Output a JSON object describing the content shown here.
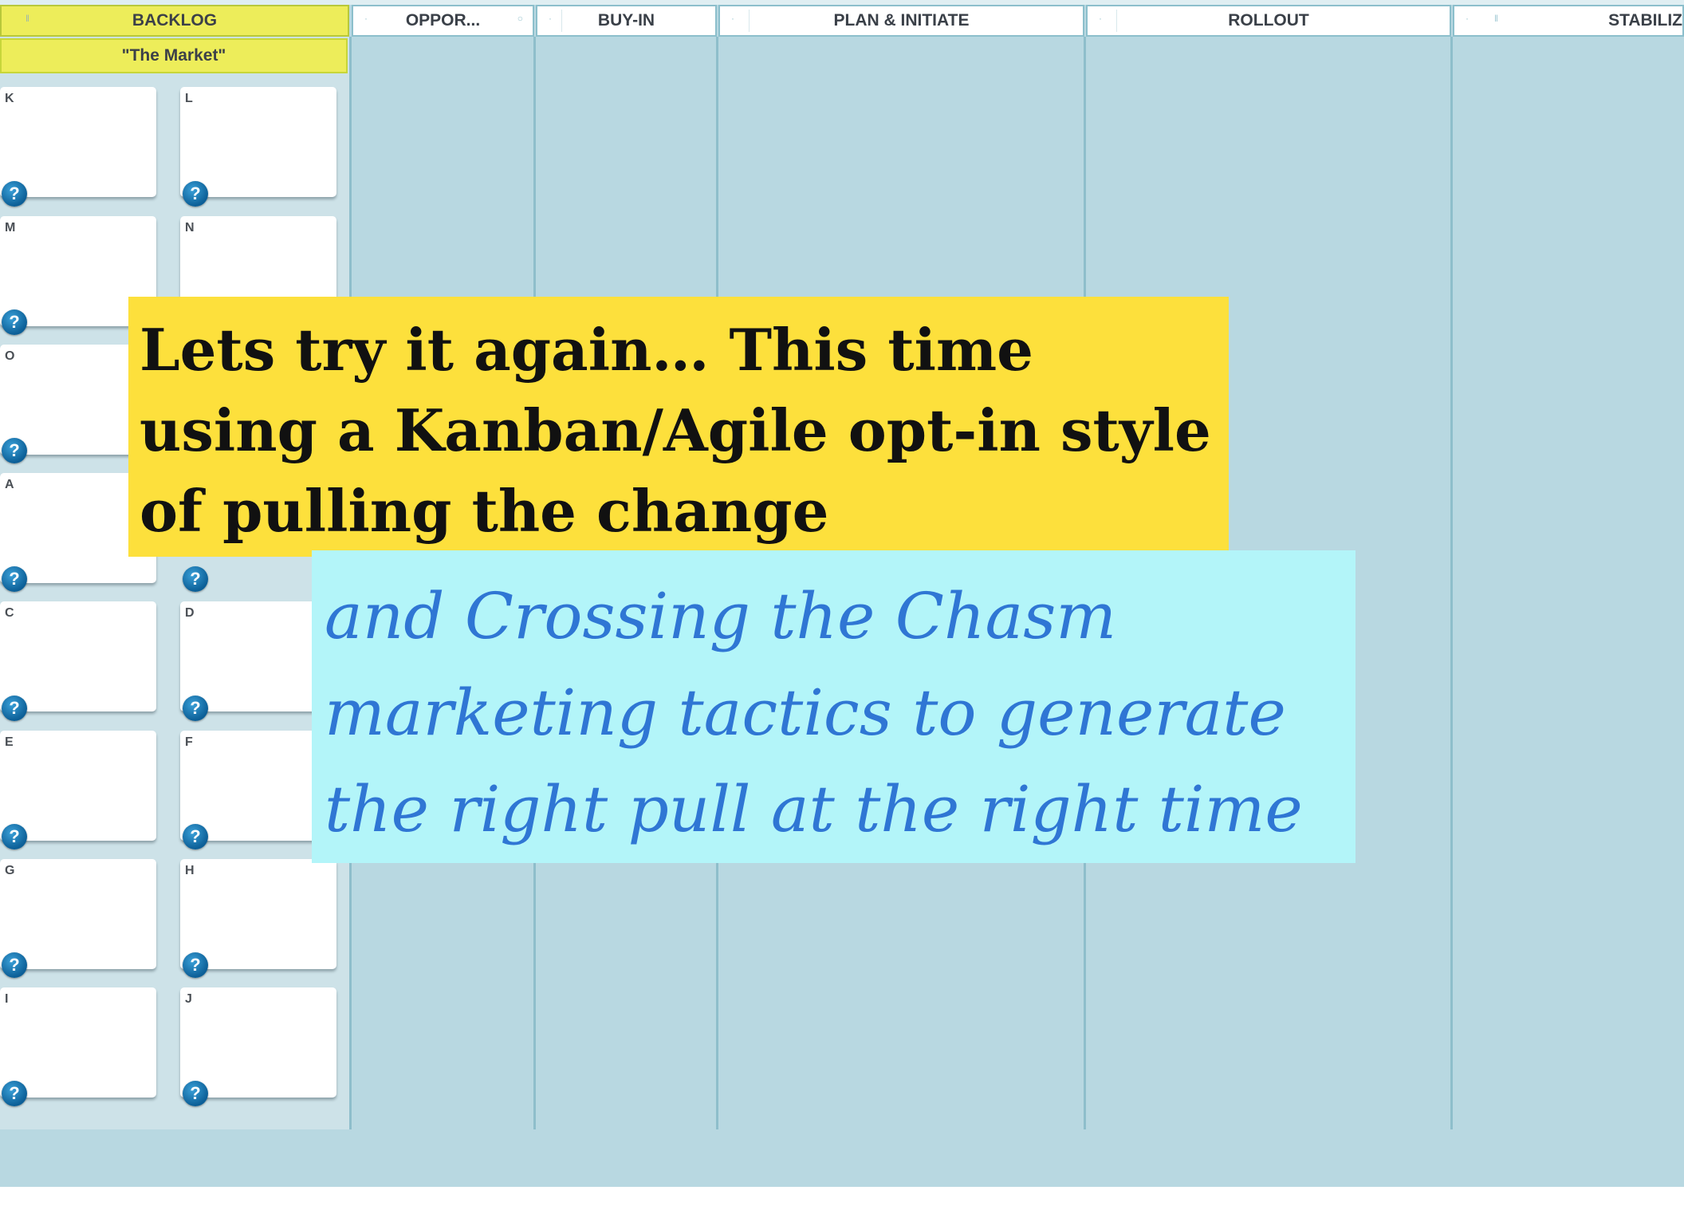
{
  "columns": [
    {
      "id": "backlog",
      "label": "BACKLOG"
    },
    {
      "id": "opportunity",
      "label": "OPPOR..."
    },
    {
      "id": "buy_in",
      "label": "BUY-IN"
    },
    {
      "id": "plan_initiate",
      "label": "PLAN & INITIATE"
    },
    {
      "id": "rollout",
      "label": "ROLLOUT"
    },
    {
      "id": "stabilize",
      "label": "STABILIZ"
    }
  ],
  "backlog": {
    "swimlane_label": "\"The Market\"",
    "cards": [
      "K",
      "L",
      "M",
      "N",
      "O",
      "",
      "A",
      "",
      "C",
      "D",
      "E",
      "F",
      "G",
      "H",
      "I",
      "J"
    ],
    "help_glyph": "?"
  },
  "callouts": {
    "headline": "Lets try it again… This time using a Kanban/Agile opt-in style of pulling the change",
    "subline": "and Crossing the Chasm marketing tactics to generate the right pull at the right time"
  },
  "colors": {
    "board_bg": "#b8d8e1",
    "backlog_header": "#eded5a",
    "headline_bg": "#fde03c",
    "subline_bg": "#b3f5f9",
    "subline_text": "#2f76d4",
    "help_icon": "#1b7cc0"
  }
}
